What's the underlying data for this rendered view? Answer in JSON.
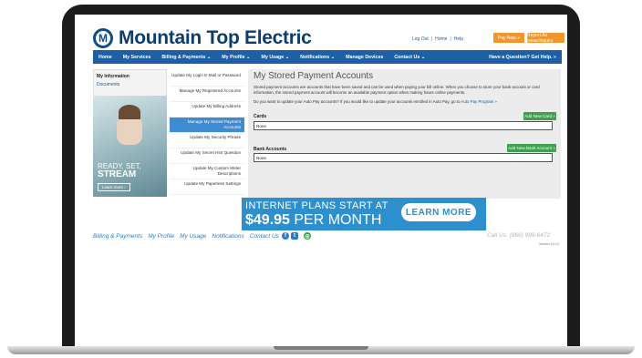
{
  "brand": {
    "name": "Mountain Top Electric",
    "mark": "M",
    "color": "#0b3e6f"
  },
  "header": {
    "links": [
      "Log Out",
      "Home",
      "Help"
    ],
    "pay_now": "Pay Now »",
    "report_issue": "Report An Issue/Inquiry"
  },
  "nav": {
    "items": [
      "Home",
      "My Services",
      "Billing & Payments ⌄",
      "My Profile ⌄",
      "My Usage ⌄",
      "Notifications ⌄",
      "Manage Devices",
      "Contact Us ⌄"
    ],
    "help": "Have a Question? Get Help. »"
  },
  "left": {
    "title": "My Information",
    "link": "Documents",
    "promo": {
      "line1": "READY, SET,",
      "line2": "STREAM",
      "button": "Learn more ›"
    }
  },
  "submenu": {
    "items": [
      "Update My Login E-Mail or Password",
      "Manage My Registered Accounts",
      "Update My Billing Address",
      "Manage My Stored Payment Accounts",
      "Update My Security Phrase",
      "Update My Secret Hint Question",
      "Update My Custom Meter Descriptions",
      "Update My Paperless Settings"
    ],
    "active_index": 3
  },
  "main": {
    "title": "My Stored Payment Accounts",
    "description": "Stored payment accounts are accounts that have been saved and can be used when paying your bill online. When you choose to store your bank account or card information, the stored payment account will become an available payment option when making future online payments.",
    "autopay_text": "Do you want to update your Auto Pay accounts? If you would like to update your accounts enrolled in Auto Pay, go to",
    "autopay_link": "Auto Pay Program »",
    "cards": {
      "label": "Cards",
      "add_button": "Add New Card »",
      "value": "None"
    },
    "bank": {
      "label": "Bank Accounts",
      "add_button": "Add New Bank Account »",
      "value": "None"
    }
  },
  "banner": {
    "line1": "INTERNET PLANS START AT",
    "price": "$49.95",
    "per": " PER MONTH",
    "button": "LEARN MORE"
  },
  "footer": {
    "links": [
      "Billing & Payments",
      "My Profile",
      "My Usage",
      "Notifications",
      "Contact Us"
    ],
    "call_us": "Call Us: (866) 999-6472",
    "version": "Version 14.0.0"
  },
  "colors": {
    "nav": "#1f5fa6",
    "accent_orange": "#f1962d",
    "green": "#3fa04f",
    "banner": "#2e8fce"
  }
}
